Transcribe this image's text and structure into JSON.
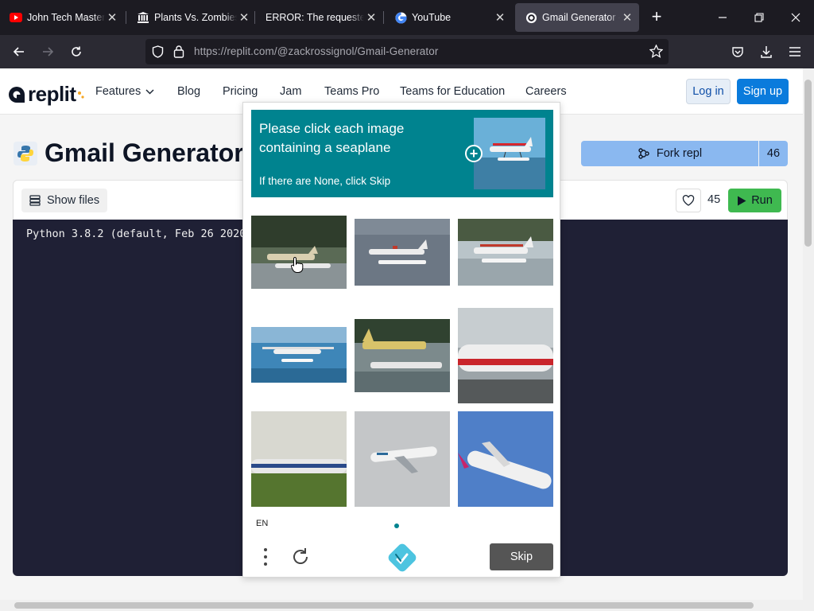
{
  "browser": {
    "tabs": [
      {
        "title": "John Tech Master -",
        "favicon": "youtube-icon"
      },
      {
        "title": "Plants Vs. Zombies",
        "favicon": "museum-icon"
      },
      {
        "title": "ERROR: The requested U",
        "favicon": "none"
      },
      {
        "title": "YouTube",
        "favicon": "google-icon"
      },
      {
        "title": "Gmail Generator - R",
        "favicon": "replit-icon",
        "active": true
      }
    ],
    "url_domain": "https://replit.com",
    "url_path": "/@zackrossignol/Gmail-Generator"
  },
  "header": {
    "logo_text": "replit",
    "nav": [
      "Features",
      "Blog",
      "Pricing",
      "Jam",
      "Teams Pro",
      "Teams for Education",
      "Careers"
    ],
    "login_label": "Log in",
    "signup_label": "Sign up"
  },
  "repl": {
    "title": "Gmail Generator",
    "fork_label": "Fork repl",
    "fork_count": "46",
    "show_files_label": "Show files",
    "like_count": "45",
    "run_label": "Run",
    "console_line": "Python 3.8.2 (default, Feb 26 2020"
  },
  "captcha": {
    "prompt": "Please click each image containing a seaplane",
    "subtext": "If there are None, click Skip",
    "language": "EN",
    "skip_label": "Skip",
    "accent_color": "#00838f",
    "tiles": [
      "seaplane-forest",
      "seaplane-water",
      "seaplane-shore",
      "seaplane-flying",
      "seaplane-yellow",
      "airliner-ground",
      "airliner-runway",
      "airliner-climb",
      "airliner-sky"
    ]
  }
}
